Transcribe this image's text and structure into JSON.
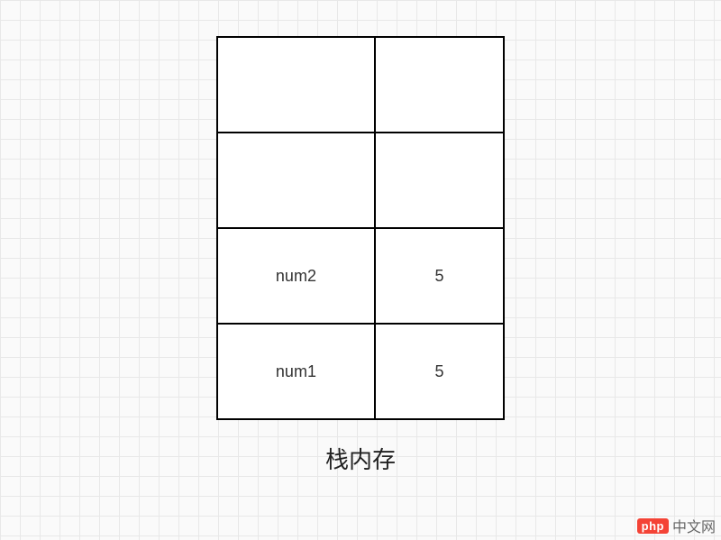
{
  "chart_data": {
    "type": "table",
    "title": "栈内存",
    "columns": [
      "name",
      "value"
    ],
    "rows": [
      {
        "name": "",
        "value": ""
      },
      {
        "name": "",
        "value": ""
      },
      {
        "name": "num2",
        "value": "5"
      },
      {
        "name": "num1",
        "value": "5"
      }
    ]
  },
  "caption": "栈内存",
  "watermark": {
    "badge": "php",
    "text": "中文网"
  }
}
